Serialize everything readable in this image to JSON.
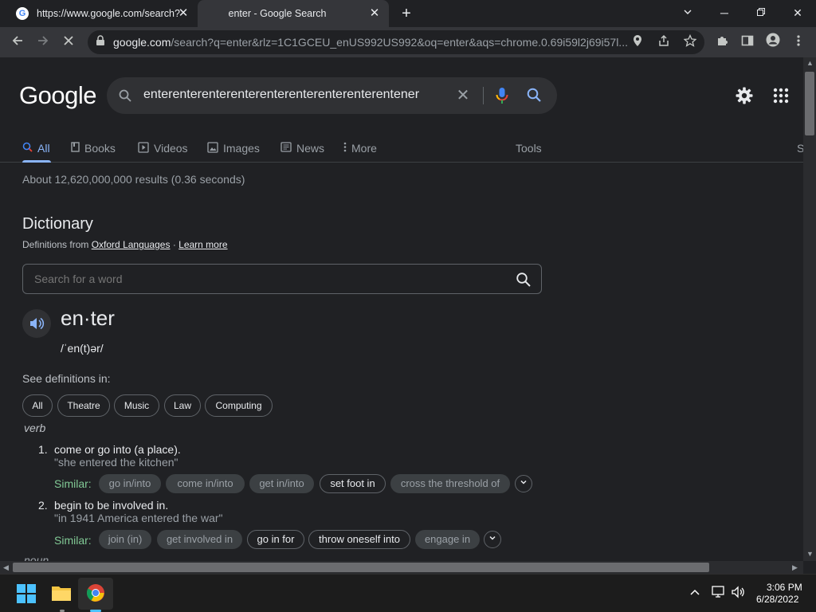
{
  "browser": {
    "tabs": [
      {
        "title": "https://www.google.com/search?",
        "active": false
      },
      {
        "title": "enter - Google Search",
        "active": true
      }
    ],
    "url_domain": "google.com",
    "url_path": "/search?q=enter&rlz=1C1GCEU_enUS992US992&oq=enter&aqs=chrome.0.69i59l2j69i57l..."
  },
  "google": {
    "logo_text": "Google",
    "query": "enterenterenterenterenterenterenterenterentener",
    "nav_tabs": [
      "All",
      "Books",
      "Videos",
      "Images",
      "News",
      "More"
    ],
    "tools_label": "Tools",
    "cut_label": "S",
    "stats": "About 12,620,000,000 results (0.36 seconds)"
  },
  "dictionary": {
    "title": "Dictionary",
    "source_prefix": "Definitions from",
    "source_link": "Oxford Languages",
    "separator": "·",
    "learn_more": "Learn more",
    "search_placeholder": "Search for a word",
    "headword": "en·ter",
    "phonetic": "/ˈen(t)ər/",
    "see_definitions": "See definitions in:",
    "chips": [
      "All",
      "Theatre",
      "Music",
      "Law",
      "Computing"
    ],
    "part_of_speech": "verb",
    "senses": [
      {
        "number": "1.",
        "definition": "come or go into (a place).",
        "example": "\"she entered the kitchen\"",
        "similar_label": "Similar:",
        "similar": [
          "go in/into",
          "come in/into",
          "get in/into",
          "set foot in",
          "cross the threshold of"
        ]
      },
      {
        "number": "2.",
        "definition": "begin to be involved in.",
        "example": "\"in 1941 America entered the war\"",
        "similar_label": "Similar:",
        "similar": [
          "join (in)",
          "get involved in",
          "go in for",
          "throw oneself into",
          "engage in"
        ]
      }
    ],
    "next_pos_partial": "noun"
  },
  "taskbar": {
    "time": "3:06 PM",
    "date": "6/28/2022"
  },
  "colors": {
    "accent_blue": "#8ab4f8",
    "similar_green": "#81c995",
    "page_bg": "#202124"
  }
}
